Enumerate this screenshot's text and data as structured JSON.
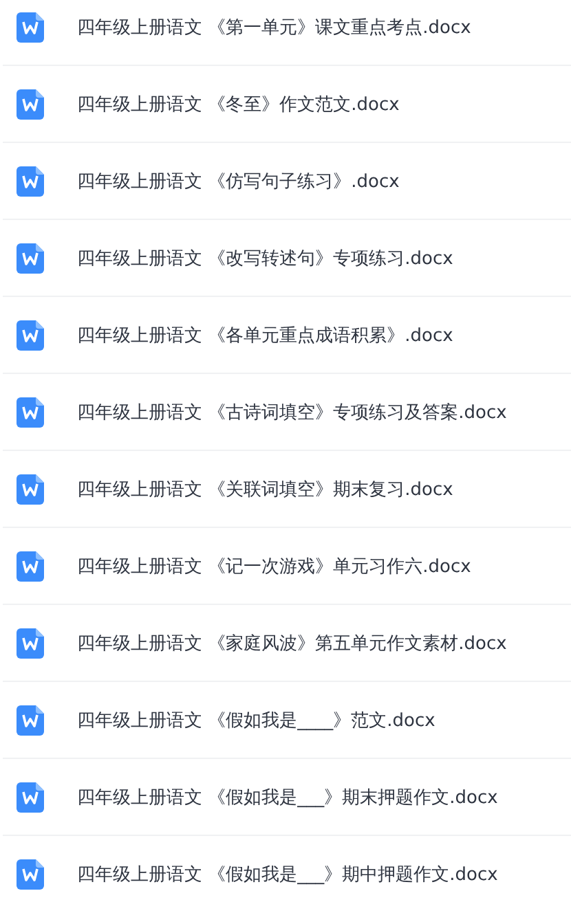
{
  "files": [
    {
      "name": "四年级上册语文 《第一单元》课文重点考点.docx"
    },
    {
      "name": "四年级上册语文 《冬至》作文范文.docx"
    },
    {
      "name": "四年级上册语文 《仿写句子练习》.docx"
    },
    {
      "name": "四年级上册语文 《改写转述句》专项练习.docx"
    },
    {
      "name": "四年级上册语文 《各单元重点成语积累》.docx"
    },
    {
      "name": "四年级上册语文 《古诗词填空》专项练习及答案.docx"
    },
    {
      "name": "四年级上册语文 《关联词填空》期末复习.docx"
    },
    {
      "name": "四年级上册语文 《记一次游戏》单元习作六.docx"
    },
    {
      "name": "四年级上册语文 《家庭风波》第五单元作文素材.docx"
    },
    {
      "name": "四年级上册语文 《假如我是____》范文.docx"
    },
    {
      "name": "四年级上册语文 《假如我是___》期末押题作文.docx"
    },
    {
      "name": "四年级上册语文 《假如我是___》期中押题作文.docx"
    }
  ]
}
